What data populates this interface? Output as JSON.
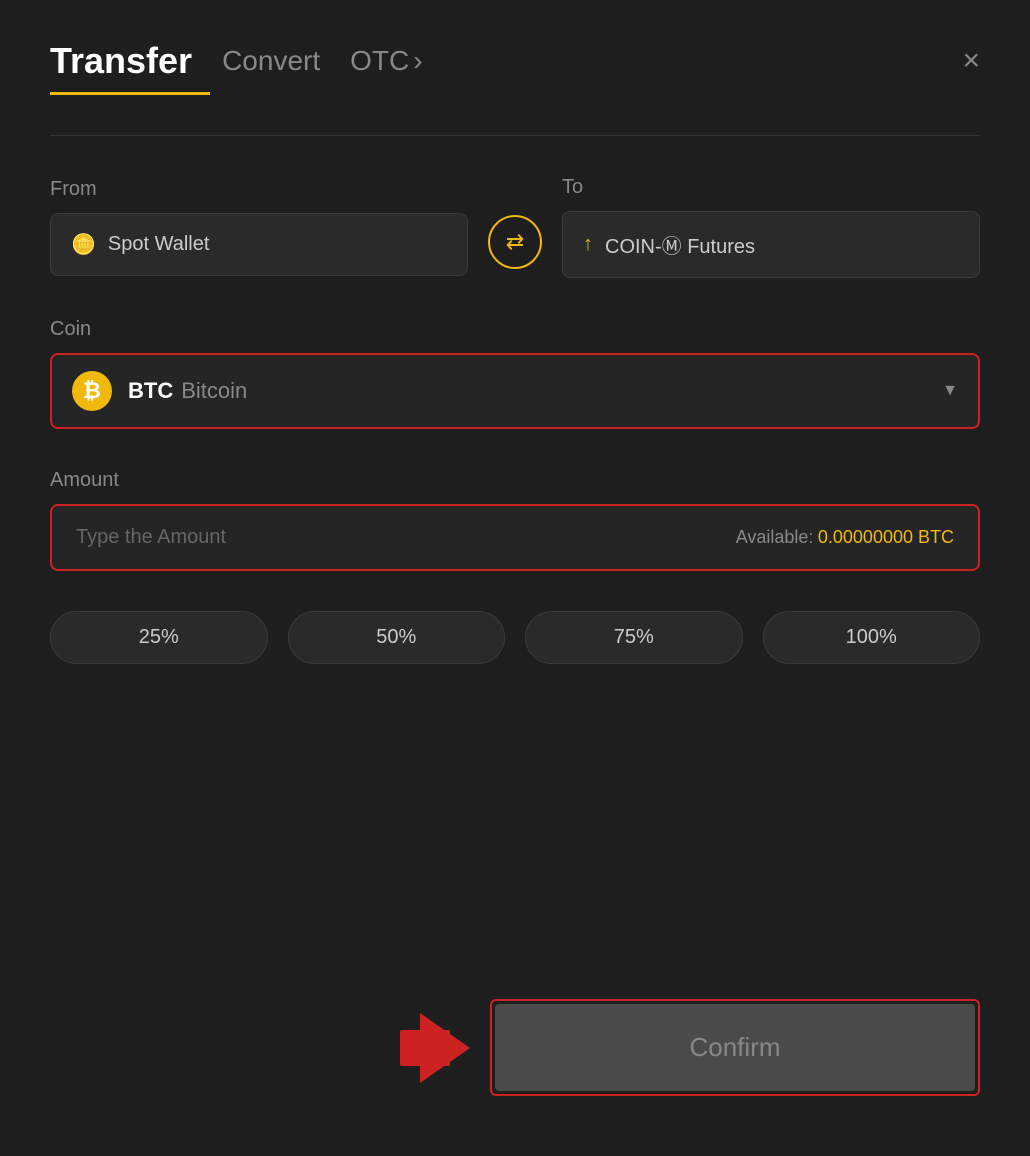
{
  "header": {
    "title": "Transfer",
    "tab_convert": "Convert",
    "tab_otc": "OTC",
    "tab_otc_chevron": "›",
    "close_label": "×"
  },
  "from_section": {
    "label": "From",
    "wallet_label": "Spot Wallet"
  },
  "to_section": {
    "label": "To",
    "wallet_label": "COIN-Ⓜ Futures"
  },
  "swap": {
    "icon": "⇄"
  },
  "coin_section": {
    "label": "Coin",
    "coin_symbol": "BTC",
    "coin_name": "Bitcoin",
    "btc_icon_label": "₿"
  },
  "amount_section": {
    "label": "Amount",
    "placeholder": "Type the Amount",
    "available_label": "Available:",
    "available_value": "0.00000000 BTC"
  },
  "percentage_buttons": [
    {
      "label": "25%"
    },
    {
      "label": "50%"
    },
    {
      "label": "75%"
    },
    {
      "label": "100%"
    }
  ],
  "confirm_button": {
    "label": "Confirm"
  }
}
